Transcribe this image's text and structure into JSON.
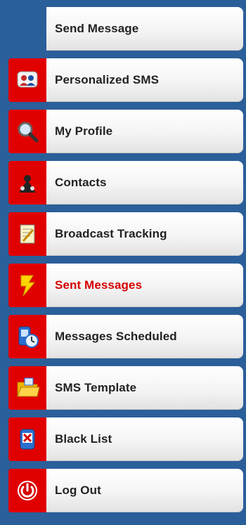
{
  "menu": {
    "items": [
      {
        "label": "Send Message",
        "icon": "none"
      },
      {
        "label": "Personalized SMS",
        "icon": "people-chat-icon"
      },
      {
        "label": "My Profile",
        "icon": "magnifier-icon"
      },
      {
        "label": "Contacts",
        "icon": "contacts-icon"
      },
      {
        "label": "Broadcast Tracking",
        "icon": "notepad-icon"
      },
      {
        "label": "Sent Messages",
        "icon": "lightning-icon",
        "active": true
      },
      {
        "label": "Messages Scheduled",
        "icon": "phone-clock-icon"
      },
      {
        "label": "SMS Template",
        "icon": "folder-icon"
      },
      {
        "label": "Black List",
        "icon": "blocked-phone-icon"
      },
      {
        "label": "Log Out",
        "icon": "power-icon"
      }
    ]
  },
  "colors": {
    "background": "#2b5f9a",
    "icon_cell": "#e10000",
    "active_label": "#d40000"
  }
}
